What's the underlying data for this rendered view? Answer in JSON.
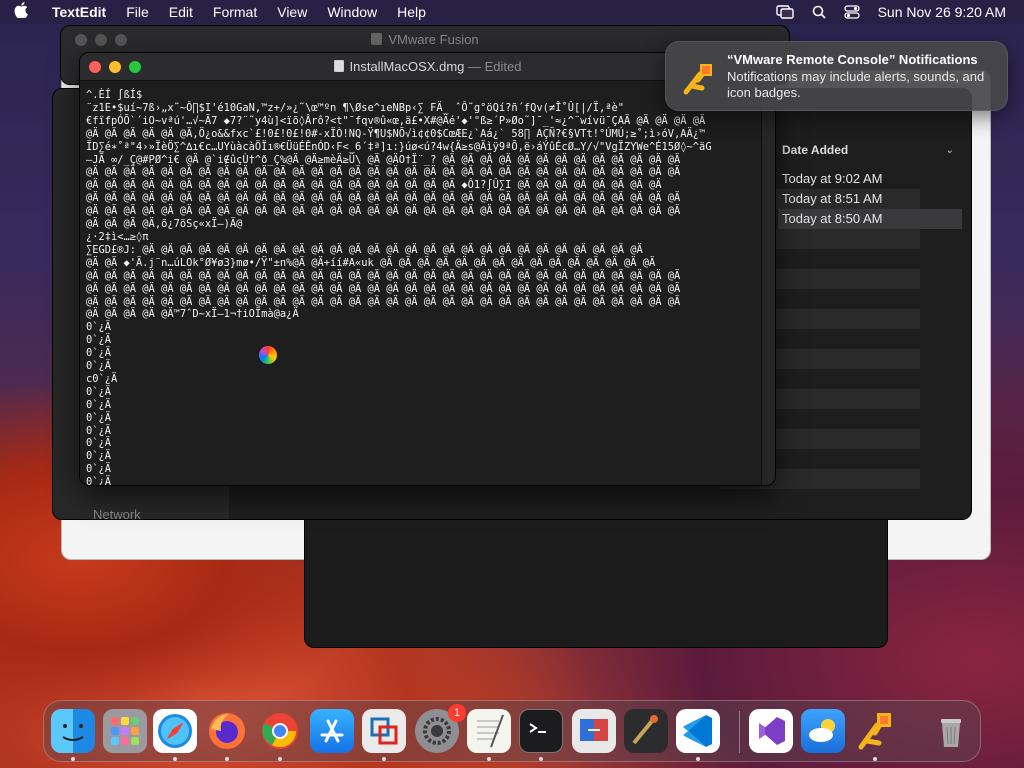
{
  "menubar": {
    "app_name": "TextEdit",
    "items": [
      "File",
      "Edit",
      "Format",
      "View",
      "Window",
      "Help"
    ],
    "clock": "Sun Nov 26  9:20 AM"
  },
  "vmware_window": {
    "title": "VMware Fusion"
  },
  "textedit": {
    "filename": "InstallMacOSX.dmg",
    "status": "— Edited",
    "lines": [
      "^.ÈÍ ∫ßÍ$",
      "¨z1E•$uí~7ß›„x˜~Ô∏$I'é10GaN,™z+/»¿˜\\œ™ºn ¶\\Øse^ıeNBp‹∑ FÄ_ ˆÔ˜g°öQí?ñ´fQv(≠Î˚Û[|/Ï,ªè\"",
      "€fïfpÓÕ`´iO~vªú'…√~Ã7 ◆7?¨˜y4ù]<ïõ◊Ârô?<t\"¯fqv®û«œ,ä£•X#@Äé'◆'\"ß≥´P»Øo˜]¯_'≈¿^¨wívü¯ÇAÄ @Ä @Ä @Ä @Ä",
      "@Ä @Ä @Ä @Ä @Ä @Ä,Ö¿o&&fxc`£!0£!0£!0#-xÏÒ!NQ-Ÿ¶U$NÕ√ì¢¢0$CœÆE¿`Aá¿` 58∏ AÇÑ?€§VTt!°ÚMÚ;≥˚;ì›óV,AÄ¿™",
      "ÏD∑é∗˚ª\"4›»ÏèÖ∑^∆ı€c…UYùàcàÖÏı®€ÜüÉÊnÓD‹F<_6´‡ª]ı:}úø<ú?4w{Ä≥s@Äìÿ9ªÕ,ë›áÝûÉcØ…Y/√\"VgÏZYWe^É15Ø◊~^äG",
      "—JÃ ∞/_Ç@#PØ^i€ @Ä @`i∉ûçÙ†^ð_Ç%@Ä @Ä≥mèÄ≥Ü\\ @Ä @ÄO†Ï¨_? @Ä @Ä @Ä @Ä @Ä @Ä @Ä @Ä @Ä @Ä @Ä @Ä @Ä",
      "@Ä @Ä @Ä @Ä @Ä @Ä @Ä @Ä @Ä @Ä @Ä @Ä @Ä @Ä @Ä @Ä @Ä @Ä @Ä @Ä @Ä @Ä @Ä @Ä @Ä @Ä @Ä @Ä @Ä @Ä @Ä @Ä",
      "@Ä @Ä @Ä @Ä @Ä @Ä @Ä @Ä @Ä @Ä @Ä @Ä @Ä @Ä @Ä @Ä @Ä @Ä @Ä @Ä ◆Ô1?∫Û∑I @Ä @Ä @Ä @Ä @Ä @Ä @Ä @Ä",
      "@Ä @Ä @Ä @Ä @Ä @Ä @Ä @Ä @Ä @Ä @Ä @Ä @Ä @Ä @Ä @Ä @Ä @Ä @Ä @Ä @Ä @Ä @Ä @Ä @Ä @Ä @Ä @Ä @Ä @Ä @Ä @Ä",
      "@Ä @Ä @Ä @Ä @Ä @Ä @Ä @Ä @Ä @Ä @Ä @Ä @Ä @Ä @Ä @Ä @Ä @Ä @Ä @Ä @Ä @Ä @Ä @Ä @Ä @Ä @Ä @Ä @Ä @Ä @Ä @Ä",
      "@Ä @Ä @Ä @Ä,õ¿7õSç«xÏ—)Ä@",
      "¿·2‡ì<…≥◊π",
      "∑EGD£®J: @Ä @Ä @Ä @Ä @Ä @Ä @Ä @Ä @Ä @Ä @Ä @Ä @Ä @Ä @Ä @Ä @Ä @Ä @Ä @Ä @Ä @Ä @Ä @Ä @Ä @Ä @Ä",
      "@Ä @Ä ◆'Ä.j¨n…úLOk°Ø¥ø3}mø•/Ÿ\"±n%@Ä @Ä+íí#A«uk @Ä @Ä @Ä @Ä @Ä @Ä @Ä @Ä @Ä @Ä @Ä @Ä @Ä @Ä @Ä",
      "@Ä @Ä @Ä @Ä @Ä @Ä @Ä @Ä @Ä @Ä @Ä @Ä @Ä @Ä @Ä @Ä @Ä @Ä @Ä @Ä @Ä @Ä @Ä @Ä @Ä @Ä @Ä @Ä @Ä @Ä @Ä @Ä",
      "@Ä @Ä @Ä @Ä @Ä @Ä @Ä @Ä @Ä @Ä @Ä @Ä @Ä @Ä @Ä @Ä @Ä @Ä @Ä @Ä @Ä @Ä @Ä @Ä @Ä @Ä @Ä @Ä @Ä @Ä @Ä @Ä",
      "@Ä @Ä @Ä @Ä @Ä @Ä @Ä @Ä @Ä @Ä @Ä @Ä @Ä @Ä @Ä @Ä @Ä @Ä @Ä @Ä @Ä @Ä @Ä @Ä @Ä @Ä @Ä @Ä @Ä @Ä @Ä @Ä",
      "@Ä @Ä @Ä @Ä @Ä™7ˆD~xÏ—1¬†iOÏmà@a¿Ä",
      "0`¿Ä",
      "0`¿Ä",
      "0`¿Ä",
      "0`¿Ä",
      "c0`¿Ä",
      "0`¿Ä",
      "0`¿Ä",
      "0`¿Ä",
      "0`¿Ä",
      "0`¿Ä",
      "0`¿Ä",
      "0`¿Ä",
      "0`¿Ä"
    ]
  },
  "notification": {
    "title": "“VMware Remote Console” Notifications",
    "body": "Notifications may include alerts, sounds, and icon badges."
  },
  "finder": {
    "column_header": "Date Added",
    "rows": [
      "Today at 9:02 AM",
      "Today at 8:51 AM",
      "Today at 8:50 AM"
    ],
    "sidebar_network": "Network"
  },
  "dock": {
    "apps": [
      "Finder",
      "Launchpad",
      "Safari",
      "Firefox",
      "Chrome",
      "App Store",
      "VMware Fusion",
      "System Settings",
      "TextEdit",
      "Terminal",
      "Migration Assistant",
      "Instruments",
      "Visual Studio Code",
      "Visual Studio",
      "Weather",
      "VMware Remote Console",
      "Trash"
    ],
    "settings_badge": "1"
  }
}
